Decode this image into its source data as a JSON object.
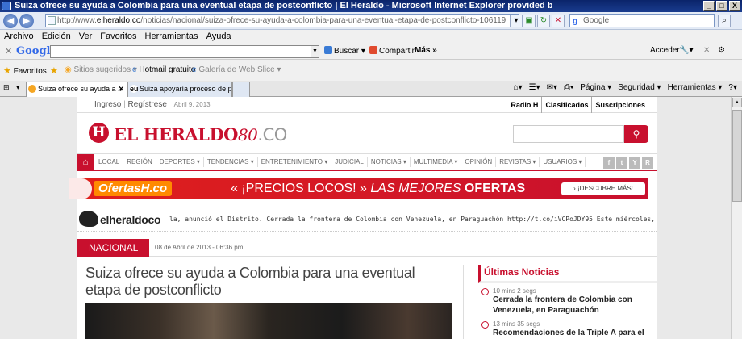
{
  "window": {
    "title": "Suiza ofrece su ayuda a Colombia para una eventual etapa de postconflicto | El Heraldo - Microsoft Internet Explorer provided b",
    "min": "_",
    "max": "□",
    "close": "X"
  },
  "address": {
    "url_prefix": "http://www.",
    "url_domain": "elheraldo.co",
    "url_rest": "/noticias/nacional/suiza-ofrece-su-ayuda-a-colombia-para-una-eventual-etapa-de-postconflicto-106119",
    "search_placeholder": "Google"
  },
  "menubar": [
    "Archivo",
    "Edición",
    "Ver",
    "Favoritos",
    "Herramientas",
    "Ayuda"
  ],
  "google_toolbar": {
    "logo": "Google",
    "buscar": "Buscar ▾",
    "compartir": "Compartir",
    "mas": "Más »",
    "acceder": "Acceder"
  },
  "favorites_bar": {
    "favoritos": "Favoritos",
    "sitios": "Sitios sugeridos ▾",
    "hotmail": "Hotmail gratuito",
    "galeria": "Galería de Web Slice ▾"
  },
  "tabs": [
    {
      "label": "Suiza ofrece su ayuda a ...",
      "active": true
    },
    {
      "label": "Suiza apoyaría proceso de p...",
      "active": false
    }
  ],
  "command_bar": [
    "Página ▾",
    "Seguridad ▾",
    "Herramientas ▾"
  ],
  "site": {
    "ingreso": "Ingreso",
    "registrese": "Regístrese",
    "top_date": "Abril 9, 2013",
    "top_links": [
      "Radio H",
      "Clasificados",
      "Suscripciones"
    ],
    "logo_letter": "H",
    "logo_name": "EL HERALDO",
    "logo_years": "80",
    "logo_tld": ".CO",
    "nav": [
      "LOCAL",
      "REGIÓN",
      "DEPORTES ▾",
      "TENDENCIAS ▾",
      "ENTRETENIMIENTO ▾",
      "JUDICIAL",
      "NOTICIAS ▾",
      "MULTIMEDIA ▾",
      "OPINIÓN",
      "REVISTAS ▾",
      "USUARIOS ▾"
    ],
    "social": [
      "f",
      "t",
      "Y",
      "R"
    ],
    "banner": {
      "brand": "OfertasH.co",
      "slogan_a": "« ¡PRECIOS LOCOS! » ",
      "slogan_b": "LAS MEJORES ",
      "slogan_c": "OFERTAS",
      "cta": "¡DESCUBRE MÁS!"
    },
    "twitter": {
      "handle": "elheraldoco",
      "ticker": "la, anunció el Distrito.    Cerrada la frontera de Colombia con Venezuela, en Paraguachón http://t.co/iVCPoJDY95    Este miércoles, pr"
    },
    "section": "NACIONAL",
    "article_date": "08 de Abril de 2013 - 06:36 pm",
    "headline": "Suiza ofrece su ayuda a Colombia para una eventual etapa de postconflicto",
    "sidebar": {
      "title": "Últimas Noticias",
      "items": [
        {
          "ago": "10 mins 2 segs",
          "text": "Cerrada la frontera de Colombia con Venezuela, en Paraguachón"
        },
        {
          "ago": "13 mins 35 segs",
          "text": "Recomendaciones de la Triple A para el"
        }
      ]
    }
  }
}
